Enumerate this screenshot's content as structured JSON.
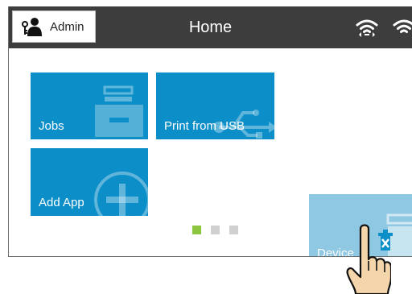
{
  "header": {
    "admin_label": "Admin",
    "title": "Home",
    "status_icons": [
      "wifi-icon",
      "wifi-direct-icon"
    ]
  },
  "tiles": [
    {
      "label": "Jobs",
      "icon": "print-queue-icon"
    },
    {
      "label": "Print from USB",
      "icon": "usb-icon"
    },
    {
      "label": "Add App",
      "icon": "plus-circle-icon"
    },
    {
      "label": "Device",
      "icon": "device-maintenance-icon"
    }
  ],
  "pager": {
    "pages": 3,
    "current": 1
  },
  "colors": {
    "topbar": "#3d3d3d",
    "tile": "#0c8ec8",
    "tile_selected": "#8fc8e3",
    "pager_active": "#8cc63f",
    "pager_inactive": "#d0d0d0",
    "hand_skin": "#f5d6ac"
  }
}
